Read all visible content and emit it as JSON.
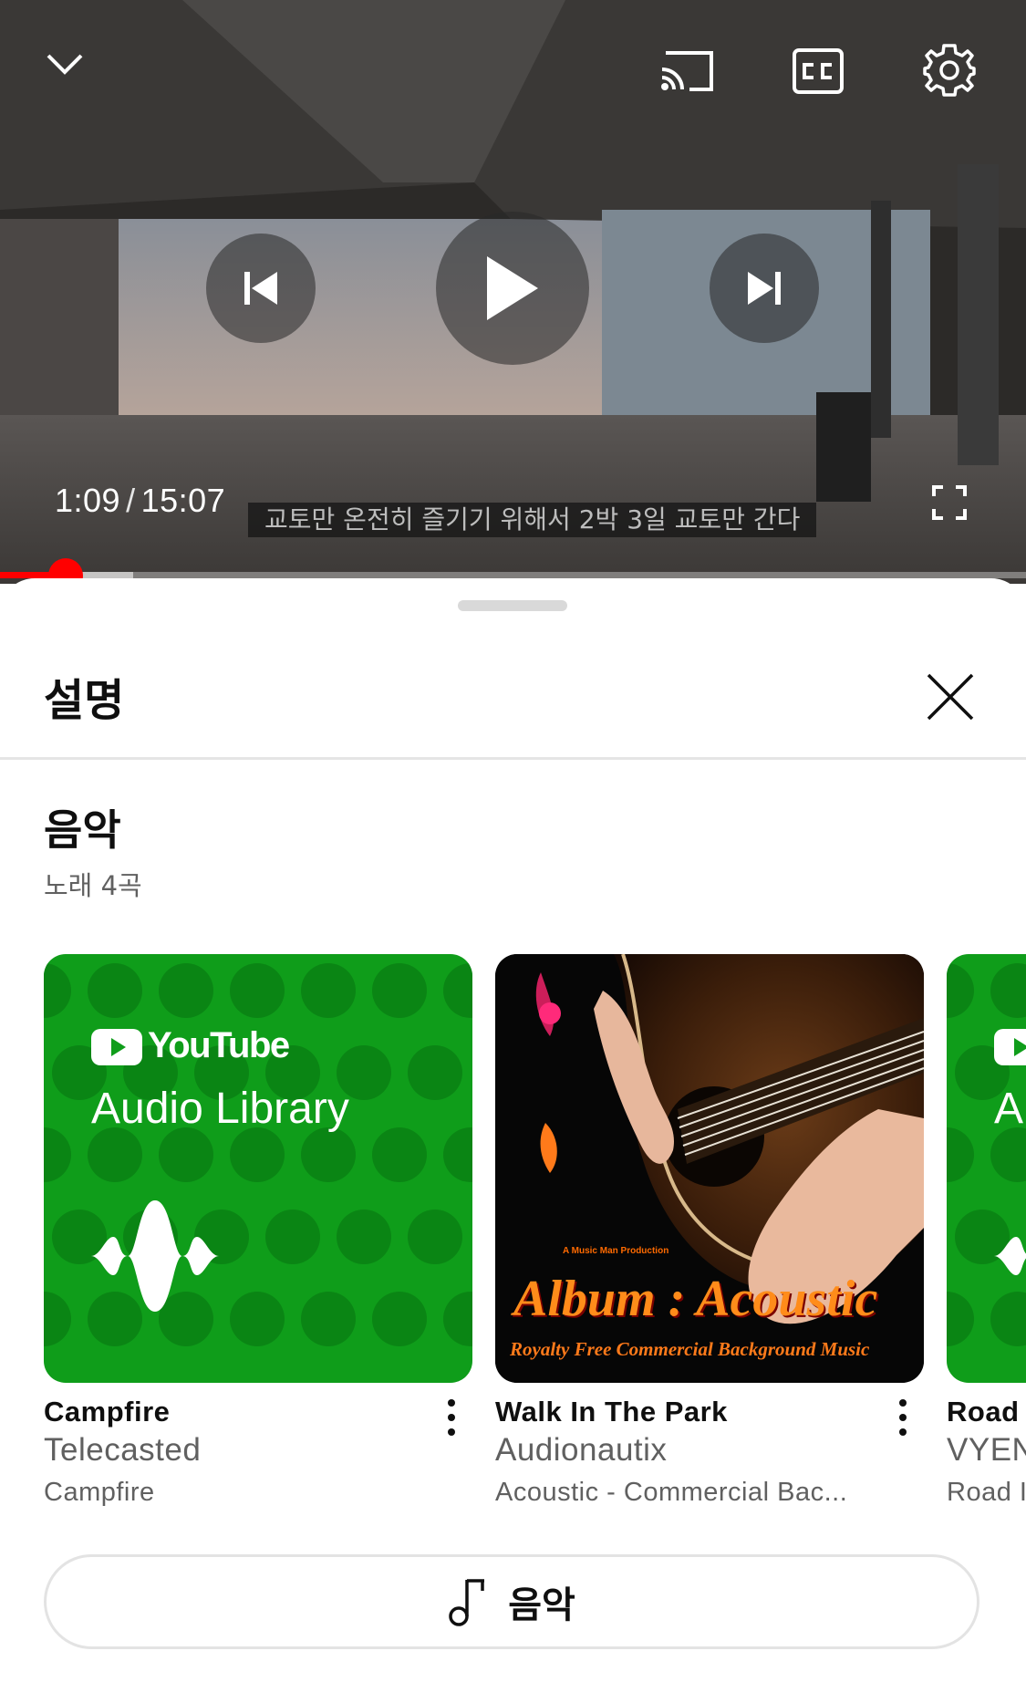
{
  "player": {
    "current_time": "1:09",
    "separator": "/",
    "duration": "15:07",
    "caption": "교토만 온전히 즐기기 위해서 2박 3일 교토만 간다",
    "progress_played_fraction": 0.064,
    "progress_buffered_fraction": 0.13,
    "accent_color": "#ff0000",
    "icons": [
      "chevron-down-icon",
      "cast-icon",
      "closed-captions-icon",
      "settings-gear-icon",
      "previous-icon",
      "play-icon",
      "next-icon",
      "fullscreen-icon"
    ]
  },
  "sheet": {
    "title": "설명",
    "section": {
      "title": "음악",
      "subtitle": "노래 4곡"
    },
    "cards": [
      {
        "title": "Campfire",
        "artist": "Telecasted",
        "album": "Campfire",
        "thumb_brand": "YouTube",
        "thumb_text": "Audio Library",
        "thumb_color": "#0f9d1a"
      },
      {
        "title": "Walk In The Park",
        "artist": "Audionautix",
        "album": "Acoustic - Commercial Bac...",
        "thumb_small": "A Music Man Production",
        "thumb_title": "Album : Acoustic",
        "thumb_sub": "Royalty Free Commercial Background Music"
      },
      {
        "title": "Road I",
        "artist": "VYEN",
        "album": "Road I",
        "thumb_text": "A",
        "thumb_color": "#0f9d1a"
      }
    ],
    "music_button_label": "음악"
  }
}
